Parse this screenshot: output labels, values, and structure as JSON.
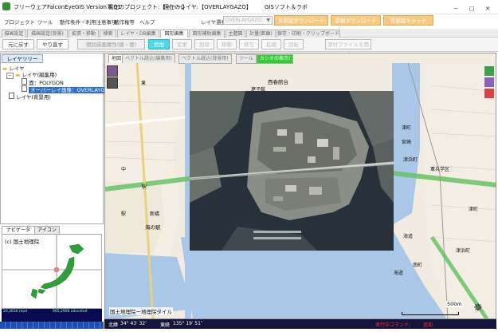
{
  "window": {
    "title": "フリーウェアFalconEyeGIS Version 6.01",
    "project": "現在のプロジェクト:【－－－】",
    "current_layer": "現在のレイヤ:【OVERLAYGAZO】",
    "brand": "GISソフト＆ラボ",
    "controls": [
      "－",
      "□",
      "✕"
    ]
  },
  "menu": {
    "items": [
      "プロジェクト",
      "ツール",
      "動作条件・利用注意事項",
      "著作権等",
      "ヘルプ"
    ],
    "layer_select_label": "レイヤ選択",
    "layer_select_value": "OVERLAYGAZO",
    "download_buttons": [
      "背景図ダウンロード",
      "景観ダウンロード",
      "背景図キャッチ"
    ]
  },
  "tabs": [
    "描画設定",
    "描画設定(背景)",
    "拡張・移動",
    "検索",
    "レイヤ・DB編集",
    "図形編集",
    "図形補助編集",
    "主題図",
    "計量(距離)",
    "保存・印刷・クリップボード"
  ],
  "active_tab": "図形編集",
  "toolbar": {
    "buttons": [
      "元に戻す",
      "やり直す",
      "個別描画属性(線・面)",
      "追加",
      "変更",
      "削除",
      "移動",
      "移写",
      "拡縮",
      "回転",
      "添付ファイルを開く"
    ]
  },
  "layer_tree": {
    "header": "レイヤツリー",
    "items": [
      "レイヤ",
      "レイヤ(編集用)",
      "面：POLYGON",
      "オーバーレイ画像：OVERLAYGAZO",
      "レイヤ(背景用)"
    ],
    "selected": "オーバーレイ画像：OVERLAYGAZO"
  },
  "navigator": {
    "tabs": [
      "ナビゲータ",
      "アイコン"
    ],
    "copyright": "(c) 国土地理院",
    "info_left": "20,3630 mod",
    "info_right": "965,2906 allocated"
  },
  "map": {
    "tabs": [
      "地図",
      "ベクトル読込(編集用)",
      "ベクトル読込(背景用)",
      "ツール",
      "カシオの表示!"
    ],
    "attribution": "国土地理院ー地理院タイル",
    "scale": "500m",
    "labels": {
      "nishiharu": "西春館台",
      "sonshi": "遼子館",
      "higashi": "東",
      "naka": "中",
      "eki1": "駅",
      "eki2": "駅",
      "shinbashi": "新橋",
      "umi": "海の駅",
      "tsumura": "津町",
      "miyazaki": "宮崎",
      "tsuhama": "津浜町",
      "kaigun": "軍兵学区",
      "tsu4": "津町",
      "tsuha": "津浜町",
      "kaidou": "海道",
      "nanshi": "南町",
      "kaidou2": "海道"
    }
  },
  "status": {
    "lat_label": "北緯",
    "lat": "34° 43′ 32″",
    "lon_label": "東経",
    "lon": "135° 19′ 51″",
    "command_label": "実行中コマンド：",
    "command": "追加"
  },
  "colors": {
    "orange": "#f8c97e",
    "cyan": "#4fd6e8",
    "selection": "#2e6fd0",
    "status_bg": "#14143c",
    "command_red": "#ff3030"
  }
}
